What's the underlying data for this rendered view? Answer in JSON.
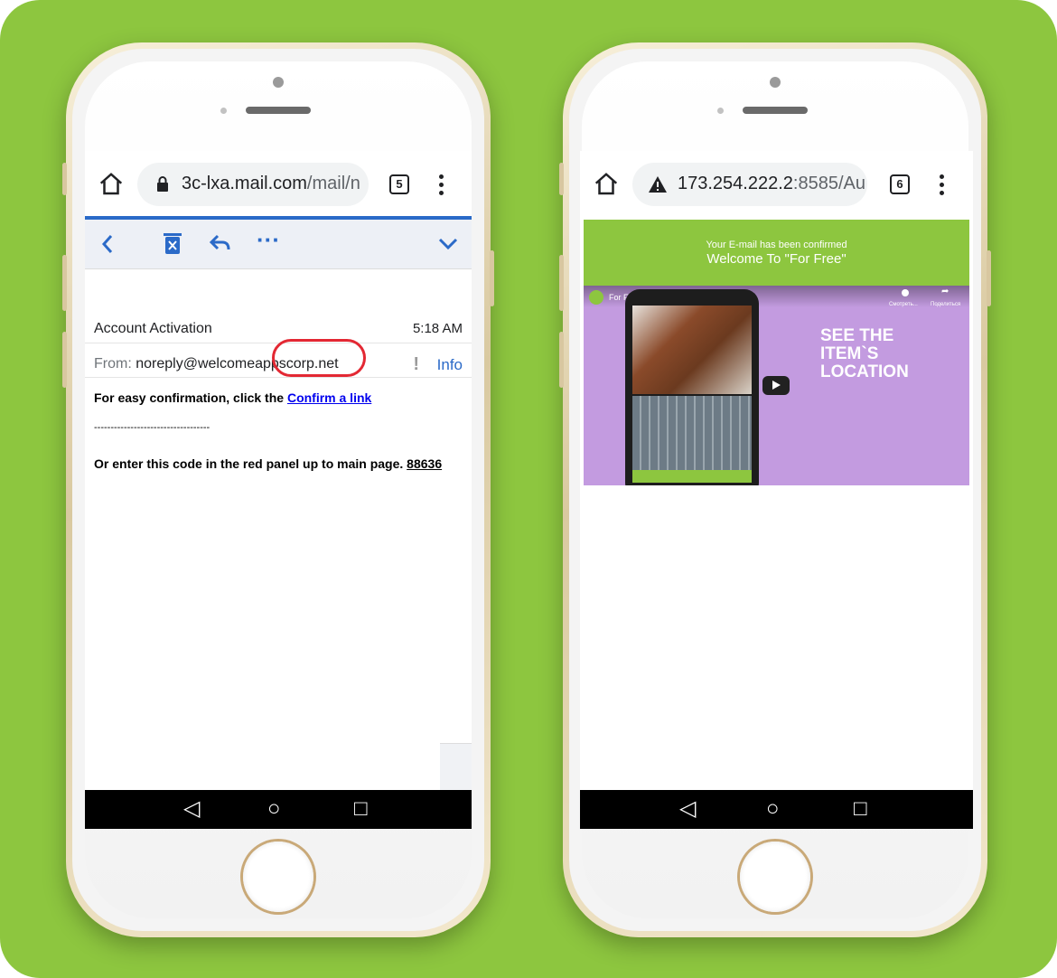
{
  "left_phone": {
    "browser": {
      "url_host": "3c-lxa.mail.com",
      "url_path": "/mail/n",
      "tab_count": "5"
    },
    "toolbar": {
      "back_icon": "chevron-left-icon",
      "delete_icon": "trash-icon",
      "reply_icon": "reply-icon",
      "more_icon": "more-horizontal-icon",
      "expand_icon": "chevron-down-icon"
    },
    "email": {
      "subject": "Account Activation",
      "time": "5:18 AM",
      "from_label": "From:",
      "from_address": "noreply@welcomeappscorp.net",
      "info_label": "Info",
      "body_prefix": "For easy confirmation, click the ",
      "body_link": "Confirm a link",
      "separator": "-----------------------------------",
      "code_text": "Or enter this code in the red panel up to main page. ",
      "code": "88636"
    }
  },
  "right_phone": {
    "browser": {
      "url_host": "173.254.222.2",
      "url_port": ":8585/Au",
      "tab_count": "6"
    },
    "page": {
      "confirmed_text": "Your E-mail has been confirmed",
      "welcome_text": "Welcome To \"For Free\"",
      "video_title": "For Free",
      "video_action_1": "Смотреть...",
      "video_action_2": "Поделиться",
      "video_headline": "SEE THE ITEM`S LOCATION"
    }
  },
  "colors": {
    "background": "#8dc63f",
    "accent_green": "#8dc63f",
    "mail_blue": "#2b6ac8",
    "highlight_red": "#e32833",
    "video_bg": "#c39be0"
  }
}
